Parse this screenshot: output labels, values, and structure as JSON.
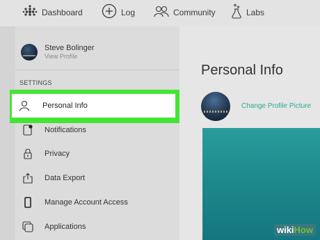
{
  "nav": {
    "items": [
      {
        "label": "Dashboard",
        "icon": "dots-grid-icon"
      },
      {
        "label": "Log",
        "icon": "plus-circle-icon"
      },
      {
        "label": "Community",
        "icon": "people-icon"
      },
      {
        "label": "Labs",
        "icon": "flask-icon"
      }
    ]
  },
  "profile": {
    "name": "Steve Bolinger",
    "subtitle": "View Profile"
  },
  "sidebar": {
    "heading": "SETTINGS",
    "items": [
      {
        "label": "Personal Info",
        "icon": "person-icon",
        "selected": true
      },
      {
        "label": "Notifications",
        "icon": "phone-notification-icon"
      },
      {
        "label": "Privacy",
        "icon": "lock-icon"
      },
      {
        "label": "Data Export",
        "icon": "upload-icon"
      },
      {
        "label": "Manage Account Access",
        "icon": "phone-icon"
      },
      {
        "label": "Applications",
        "icon": "apps-icon"
      }
    ]
  },
  "main": {
    "title": "Personal Info",
    "change_picture": "Change Profile Picture"
  },
  "watermark": {
    "prefix": "wiki",
    "suffix": "How"
  },
  "colors": {
    "highlight": "#44e534",
    "link": "#2aa88f",
    "cover": "#1e8a8d"
  }
}
